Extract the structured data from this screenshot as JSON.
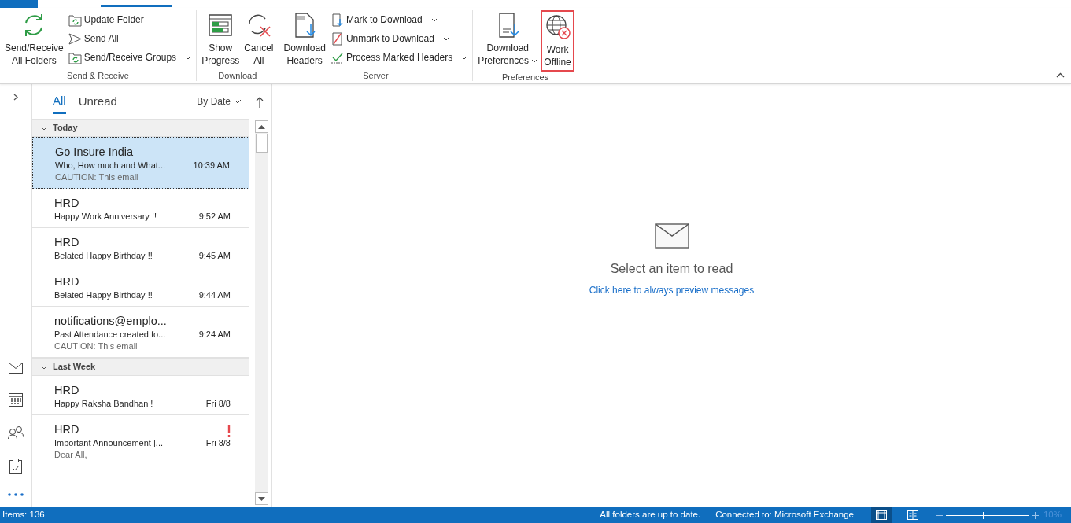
{
  "ribbon": {
    "groups": [
      {
        "label": "Send & Receive",
        "items": [
          {
            "kind": "large",
            "lines": [
              "Send/Receive",
              "All Folders"
            ],
            "dropdown": false,
            "highlighted": false
          },
          {
            "kind": "small",
            "lines": [
              "Update Folder"
            ],
            "dropdown": false,
            "highlighted": false
          },
          {
            "kind": "small",
            "lines": [
              "Send All"
            ],
            "dropdown": false,
            "highlighted": false
          },
          {
            "kind": "small",
            "lines": [
              "Send/Receive Groups"
            ],
            "dropdown": true,
            "highlighted": false
          }
        ]
      },
      {
        "label": "Download",
        "items": [
          {
            "kind": "large",
            "lines": [
              "Show",
              "Progress"
            ],
            "dropdown": false,
            "highlighted": false
          },
          {
            "kind": "large",
            "lines": [
              "Cancel",
              "All"
            ],
            "dropdown": false,
            "highlighted": false
          }
        ]
      },
      {
        "label": "Server",
        "items": [
          {
            "kind": "large",
            "lines": [
              "Download",
              "Headers"
            ],
            "dropdown": false,
            "highlighted": false
          },
          {
            "kind": "small",
            "lines": [
              "Mark to Download"
            ],
            "dropdown": true,
            "highlighted": false
          },
          {
            "kind": "small",
            "lines": [
              "Unmark to Download"
            ],
            "dropdown": true,
            "highlighted": false
          },
          {
            "kind": "small",
            "lines": [
              "Process Marked Headers"
            ],
            "dropdown": true,
            "highlighted": false
          }
        ]
      },
      {
        "label": "Preferences",
        "items": [
          {
            "kind": "large",
            "lines": [
              "Download",
              "Preferences"
            ],
            "dropdown": true,
            "highlighted": false
          },
          {
            "kind": "large",
            "lines": [
              "Work",
              "Offline"
            ],
            "dropdown": false,
            "highlighted": true
          }
        ]
      }
    ]
  },
  "message_list": {
    "filters": [
      {
        "label": "All",
        "selected": true
      },
      {
        "label": "Unread",
        "selected": false
      }
    ],
    "sort": "By Date",
    "groups": [
      {
        "label": "Today",
        "expanded": true,
        "messages": [
          {
            "sender": "Go Insure India",
            "subject": "Who, How much and What...",
            "time": "10:39 AM",
            "preview": "CAUTION: This email",
            "selected": true,
            "important": false
          },
          {
            "sender": "HRD",
            "subject": "Happy Work Anniversary !!",
            "time": "9:52 AM",
            "selected": false,
            "important": false
          },
          {
            "sender": "HRD",
            "subject": "Belated Happy Birthday !!",
            "time": "9:45 AM",
            "selected": false,
            "important": false
          },
          {
            "sender": "HRD",
            "subject": "Belated Happy Birthday !!",
            "time": "9:44 AM",
            "selected": false,
            "important": false
          },
          {
            "sender": "notifications@emplo...",
            "subject": "Past Attendance created fo...",
            "time": "9:24 AM",
            "preview": "CAUTION: This email",
            "selected": false,
            "important": false
          }
        ]
      },
      {
        "label": "Last Week",
        "expanded": true,
        "messages": [
          {
            "sender": "HRD",
            "subject": "Happy Raksha Bandhan !",
            "time": "Fri 8/8",
            "selected": false,
            "important": false
          },
          {
            "sender": "HRD",
            "subject": "Important Announcement |...",
            "time": "Fri 8/8",
            "preview": "Dear All,",
            "selected": false,
            "important": true
          }
        ]
      }
    ]
  },
  "reading_pane": {
    "message": "Select an item to read",
    "link": "Click here to always preview messages"
  },
  "status_bar": {
    "items": "Items: 136",
    "sync": "All folders are up to date.",
    "connection": "Connected to: Microsoft Exchange",
    "views": [
      {
        "selected": true
      },
      {
        "selected": false
      }
    ],
    "zoom": {
      "level": 0.45,
      "reading": "10%"
    }
  }
}
